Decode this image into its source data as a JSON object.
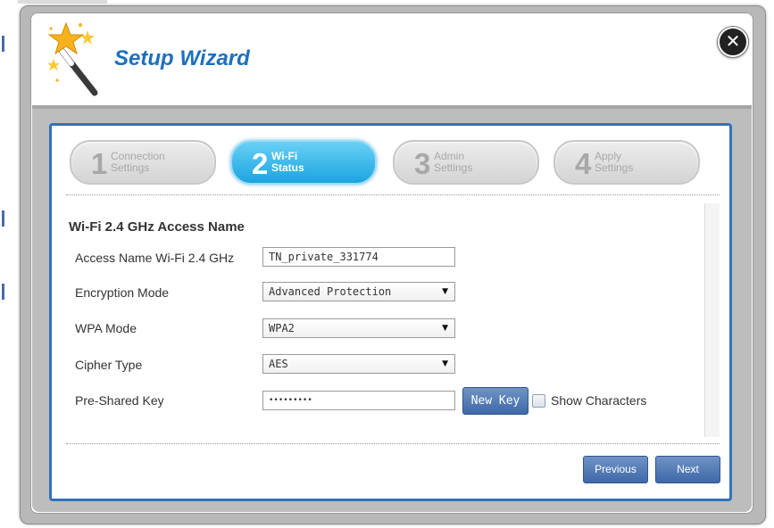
{
  "header": {
    "title": "Setup Wizard"
  },
  "steps": [
    {
      "num": "1",
      "line1": "Connection",
      "line2": "Settings",
      "active": false
    },
    {
      "num": "2",
      "line1": "Wi-Fi",
      "line2": "Status",
      "active": true
    },
    {
      "num": "3",
      "line1": "Admin",
      "line2": "Settings",
      "active": false
    },
    {
      "num": "4",
      "line1": "Apply",
      "line2": "Settings",
      "active": false
    }
  ],
  "form": {
    "section_title": "Wi-Fi 2.4 GHz Access Name",
    "access_name": {
      "label": "Access Name Wi-Fi 2.4 GHz",
      "value": "TN_private_331774"
    },
    "encryption_mode": {
      "label": "Encryption Mode",
      "value": "Advanced Protection"
    },
    "wpa_mode": {
      "label": "WPA Mode",
      "value": "WPA2"
    },
    "cipher_type": {
      "label": "Cipher Type",
      "value": "AES"
    },
    "psk": {
      "label": "Pre-Shared Key",
      "value": "•••••••••"
    },
    "new_key_label": "New Key",
    "show_characters_label": "Show Characters"
  },
  "buttons": {
    "previous": "Previous",
    "next": "Next"
  },
  "icons": {
    "close": "close-icon",
    "wand": "magic-wand-icon",
    "dropdown": "dropdown-arrow-icon"
  },
  "colors": {
    "accent": "#1e6fbd",
    "active_step": "#1ba4e0",
    "button": "#4f76b2"
  }
}
